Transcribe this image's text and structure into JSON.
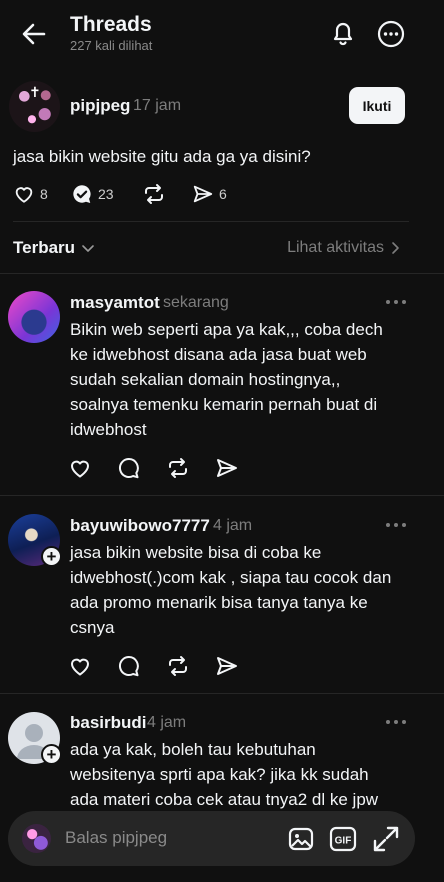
{
  "header": {
    "title": "Threads",
    "subtitle": "227 kali dilihat"
  },
  "post": {
    "username": "pipjpeg",
    "time": "17 jam",
    "follow_label": "Ikuti",
    "text": "jasa bikin website gitu ada ga ya disini?",
    "likes": "8",
    "replies": "23",
    "shares": "6"
  },
  "sort": {
    "label": "Terbaru",
    "activity_label": "Lihat aktivitas"
  },
  "replies": [
    {
      "username": "masyamtot",
      "time": "sekarang",
      "lines": [
        "Bikin web seperti apa ya kak,,, coba dech",
        "ke idwebhost disana ada jasa buat web",
        "sudah sekalian domain hostingnya,,",
        "soalnya temenku kemarin pernah buat di",
        "idwebhost"
      ]
    },
    {
      "username": "bayuwibowo7777",
      "time": "4 jam",
      "lines": [
        "jasa bikin website bisa di coba ke",
        "idwebhost(.)com kak , siapa tau cocok dan",
        "ada promo menarik bisa tanya tanya ke",
        "csnya"
      ]
    },
    {
      "username": "basirbudi",
      "time": "4 jam",
      "lines": [
        "ada ya kak,  boleh tau kebutuhan",
        "websitenya sprti apa kak? jika kk sudah",
        "ada materi coba cek atau tnya2 dl ke jpw"
      ]
    }
  ],
  "composer": {
    "placeholder": "Balas pipjpeg",
    "gif_label": "GIF"
  },
  "colors": {
    "background": "#101010",
    "text": "#f3f5f7",
    "muted": "#7d7d7d",
    "composer_bg": "#262626"
  }
}
